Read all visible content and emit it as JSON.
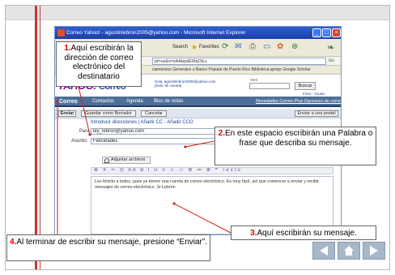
{
  "browser": {
    "window_title": "Correo Yahoo! - agustinlebron2005@yahoo.com - Microsoft Internet Explorer",
    "toolbar_search": "Search",
    "toolbar_favorites": "Favorites",
    "address_value": "pl=us&v=zAAbpdE6tqOtLc",
    "go_label": "Go",
    "links_label": "ciamientos Generales u    Banco Popular de Puerto Rico    Biblioteca.upmpr    Google Scholar"
  },
  "yahoo": {
    "logo_text": "YAHOO!",
    "logo_product": "Correo",
    "greeting": "Hola, agustinlebron2005@yahoo.com",
    "signout": "[Salir, Mi cuenta]",
    "search_label": "Buscar",
    "search_scope": "Web",
    "search_button": "Buscar",
    "help_links": "Inicio - Ayuda",
    "nav": [
      "Correo",
      "Contactos",
      "Agenda",
      "Bloc de notas"
    ],
    "nav_links": "Novedades  Correo Plus  Opciones de correo",
    "actions": {
      "send": "Enviar",
      "save_draft": "Guardar como Borrador",
      "cancel": "Cancelar",
      "plain": "Enviar a una postal"
    },
    "form": {
      "insert_addresses": "Introducir direcciones  |  Añadir CC  -  Añadir CCO",
      "to_label": "Para:",
      "to_value": "ley_lebron@yahoo.com",
      "subject_label": "Asunto:",
      "subject_value": "Felicidades",
      "attach_label": "Adjuntar archivos",
      "format_tools": "⊗ ✕ ✂ ⎘ Ab  B I U ≡ ☺ ⚇ ⚙ ≔ ≣ ❝ Texto",
      "body_text": "Les felicito a todos, pues ya tienen una cuenta de correo electrónico. Es muy fácil, así que comencer a enviar y recibir mensajes de correo electrónico. Sr.Lebrón"
    }
  },
  "callouts": {
    "c1_num": "1.",
    "c1_text": "Aquí escribirán la dirección de correo electrónico del destinatario",
    "c2_num": "2.",
    "c2_text": "En este espacio escribirán una Palabra o frase que describa su mensaje.",
    "c3_num": "3.",
    "c3_text": "Aquí escribirán su mensaje.",
    "c4_num": "4.",
    "c4_text": "Al terminar de escribir su mensaje, presione “Enviar”."
  },
  "slide_nav": {
    "prev_icon": "triangle-left-icon",
    "home_icon": "house-icon",
    "next_icon": "triangle-right-icon"
  },
  "colors": {
    "accent_red": "#e00000",
    "yahoo_purple": "#7b0099",
    "nav_blue": "#4f6e97",
    "slide_nav": "#a6b8c9"
  }
}
